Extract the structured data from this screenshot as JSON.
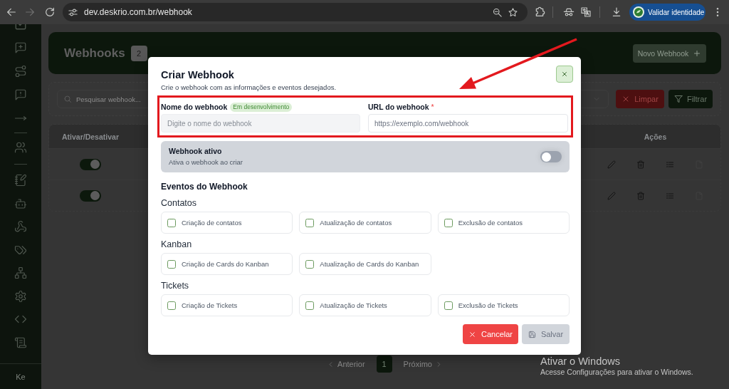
{
  "browser": {
    "url": "dev.deskrio.com.br/webhook",
    "profile_button": "Validar identidade"
  },
  "sidebar": {
    "user_initials": "Ke"
  },
  "page": {
    "title": "Webhooks",
    "count": "2",
    "new_button": "Novo Webhook",
    "search": {
      "placeholder": "Pesquisar webhook..."
    },
    "clear_button": "Limpar",
    "filter_button": "Filtrar",
    "table": {
      "columns": [
        "Ativar/Desativar",
        "Ações"
      ],
      "rows": [
        {
          "active": true
        },
        {
          "active": true
        }
      ]
    },
    "pagination": {
      "previous": "Anterior",
      "pages": [
        {
          "label": "1",
          "selected": true
        }
      ],
      "next": "Próximo"
    }
  },
  "modal": {
    "title": "Criar Webhook",
    "subtitle": "Crie o webhook com as informações e eventos desejados.",
    "fields": [
      {
        "label": "Nome do webhook",
        "badge": "Em desenvolvimento",
        "placeholder": "Digite o nome do webhook",
        "disabled": true
      },
      {
        "label": "URL do webhook",
        "required_mark": "*",
        "placeholder": "https://exemplo.com/webhook",
        "disabled": false
      }
    ],
    "active_toggle": {
      "label": "Webhook ativo",
      "description": "Ativa o webhook ao criar",
      "on": false
    },
    "events_title": "Eventos do Webhook",
    "event_groups": [
      {
        "name": "Contatos",
        "events": [
          {
            "label": "Criação de contatos",
            "checked": false
          },
          {
            "label": "Atualização de contatos",
            "checked": false
          },
          {
            "label": "Exclusão de contatos",
            "checked": false
          }
        ]
      },
      {
        "name": "Kanban",
        "events": [
          {
            "label": "Criação de Cards do Kanban",
            "checked": false
          },
          {
            "label": "Atualização de Cards do Kanban",
            "checked": false
          }
        ]
      },
      {
        "name": "Tickets",
        "events": [
          {
            "label": "Criação de Tickets",
            "checked": false
          },
          {
            "label": "Atualização de Tickets",
            "checked": false
          },
          {
            "label": "Exclusão de Tickets",
            "checked": false
          }
        ]
      }
    ],
    "buttons": [
      {
        "label": "Cancelar",
        "kind": "cancel",
        "disabled": false
      },
      {
        "label": "Salvar",
        "kind": "save",
        "disabled": true
      }
    ]
  },
  "os_notice": {
    "title": "Ativar o Windows",
    "text": "Acesse Configurações para ativar o Windows."
  }
}
